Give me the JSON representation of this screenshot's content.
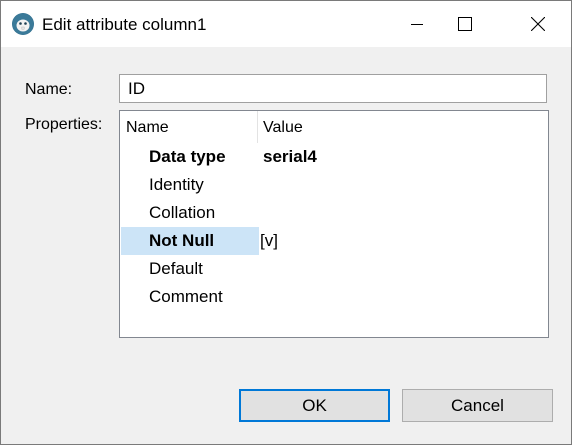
{
  "window": {
    "title": "Edit attribute column1",
    "app_icon": "dbeaver-icon"
  },
  "form": {
    "name_label": "Name:",
    "name_value": "ID",
    "properties_label": "Properties:"
  },
  "properties": {
    "columns": [
      "Name",
      "Value"
    ],
    "rows": [
      {
        "name": "Data type",
        "value": "serial4",
        "bold": true,
        "selected": false
      },
      {
        "name": "Identity",
        "value": "",
        "bold": false,
        "selected": false
      },
      {
        "name": "Collation",
        "value": "",
        "bold": false,
        "selected": false
      },
      {
        "name": "Not Null",
        "value": "[v]",
        "bold": true,
        "selected": true
      },
      {
        "name": "Default",
        "value": "",
        "bold": false,
        "selected": false
      },
      {
        "name": "Comment",
        "value": "",
        "bold": false,
        "selected": false
      }
    ],
    "selection_color": "#cce4f7"
  },
  "buttons": {
    "ok": "OK",
    "cancel": "Cancel"
  },
  "colors": {
    "focus_border": "#0078d7"
  }
}
